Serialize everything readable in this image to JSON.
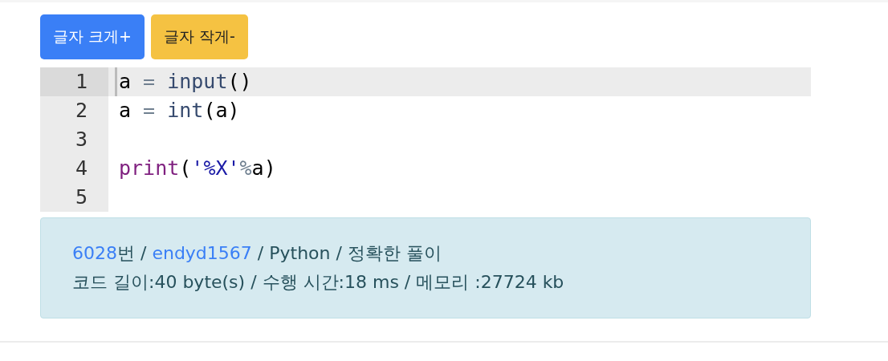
{
  "buttons": [
    {
      "label": "글자 크게+",
      "kind": "primary"
    },
    {
      "label": "글자 작게-",
      "kind": "warning"
    }
  ],
  "editor": {
    "lines": [
      {
        "number": "1",
        "selected": true,
        "tokens": [
          {
            "kind": "plain",
            "text": "a "
          },
          {
            "kind": "operator",
            "text": "= "
          },
          {
            "kind": "builtin",
            "text": "input"
          },
          {
            "kind": "plain",
            "text": "()"
          }
        ]
      },
      {
        "number": "2",
        "selected": false,
        "tokens": [
          {
            "kind": "plain",
            "text": "a "
          },
          {
            "kind": "operator",
            "text": "= "
          },
          {
            "kind": "builtin",
            "text": "int"
          },
          {
            "kind": "plain",
            "text": "(a)"
          }
        ]
      },
      {
        "number": "3",
        "selected": false
      },
      {
        "number": "4",
        "selected": false,
        "tokens": [
          {
            "kind": "keyword",
            "text": "print"
          },
          {
            "kind": "plain",
            "text": "("
          },
          {
            "kind": "string",
            "text": "'%X'"
          },
          {
            "kind": "operator",
            "text": "%"
          },
          {
            "kind": "plain",
            "text": "a)"
          }
        ]
      },
      {
        "number": "5",
        "selected": false
      }
    ]
  },
  "result": {
    "lines": [
      [
        {
          "kind": "link",
          "text": "6028"
        },
        {
          "kind": "text",
          "text": "번 / "
        },
        {
          "kind": "link",
          "text": "endyd1567"
        },
        {
          "kind": "text",
          "text": " / Python / 정확한 풀이"
        }
      ],
      [
        {
          "kind": "text",
          "text": "코드 길이:40 byte(s) / 수행 시간:18 ms / 메모리 :27724 kb"
        }
      ]
    ]
  }
}
